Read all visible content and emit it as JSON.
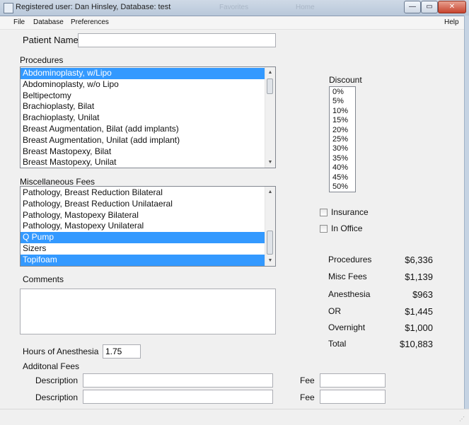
{
  "window": {
    "title": "Registered user: Dan Hinsley, Database: test",
    "ghost_tab_1": "Favorites",
    "ghost_tab_2": "Home"
  },
  "menu": {
    "file": "File",
    "database": "Database",
    "preferences": "Preferences",
    "help": "Help"
  },
  "patient": {
    "label": "Patient Name",
    "value": ""
  },
  "procedures": {
    "label": "Procedures",
    "items": [
      {
        "label": "Abdominoplasty, w/Lipo",
        "selected": true
      },
      {
        "label": "Abdominoplasty, w/o Lipo",
        "selected": false
      },
      {
        "label": "Beltipectomy",
        "selected": false
      },
      {
        "label": "Brachioplasty, Bilat",
        "selected": false
      },
      {
        "label": "Brachioplasty, Unilat",
        "selected": false
      },
      {
        "label": "Breast Augmentation, Bilat (add implants)",
        "selected": false
      },
      {
        "label": "Breast Augmentation, Unilat (add implant)",
        "selected": false
      },
      {
        "label": "Breast Mastopexy, Bilat",
        "selected": false
      },
      {
        "label": "Breast Mastopexy, Unilat",
        "selected": false
      }
    ]
  },
  "misc": {
    "label": "Miscellaneous Fees",
    "items": [
      {
        "label": "Pathology, Breast Reduction Bilateral",
        "selected": false
      },
      {
        "label": "Pathology, Breast Reduction Unilataeral",
        "selected": false
      },
      {
        "label": "Pathology, Mastopexy Bilateral",
        "selected": false
      },
      {
        "label": "Pathology, Mastopexy Unilateral",
        "selected": false
      },
      {
        "label": "Q Pump",
        "selected": true
      },
      {
        "label": "Sizers",
        "selected": false
      },
      {
        "label": "Topifoam",
        "selected": true
      }
    ]
  },
  "comments": {
    "label": "Comments",
    "value": ""
  },
  "anesthesia": {
    "label": "Hours of Anesthesia",
    "value": "1.75"
  },
  "additional": {
    "label": "Additonal Fees",
    "desc_label": "Description",
    "fee_label": "Fee"
  },
  "discount": {
    "label": "Discount",
    "options": [
      "0%",
      "5%",
      "10%",
      "15%",
      "20%",
      "25%",
      "30%",
      "35%",
      "40%",
      "45%",
      "50%"
    ]
  },
  "checkboxes": {
    "insurance": "Insurance",
    "in_office": "In Office"
  },
  "totals": [
    {
      "label": "Procedures",
      "value": "$6,336"
    },
    {
      "label": "Misc Fees",
      "value": "$1,139"
    },
    {
      "label": "Anesthesia",
      "value": "$963"
    },
    {
      "label": "OR",
      "value": "$1,445"
    },
    {
      "label": "Overnight",
      "value": "$1,000"
    },
    {
      "label": "Total",
      "value": "$10,883"
    }
  ],
  "window_controls": {
    "minimize": "—",
    "maximize": "▭",
    "close": "✕"
  }
}
